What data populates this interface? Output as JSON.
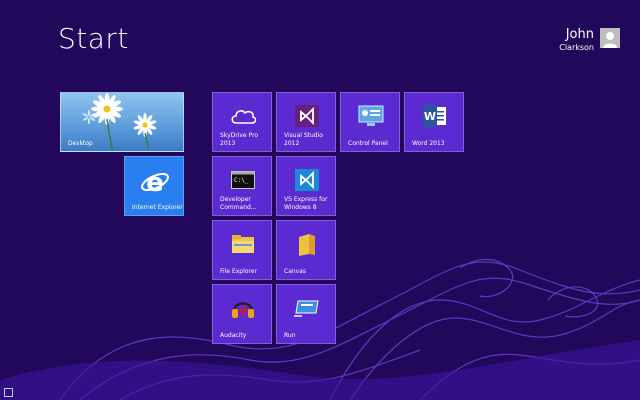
{
  "screen": {
    "title": "Start"
  },
  "user": {
    "first_name": "John",
    "last_name": "Clarkson"
  },
  "tiles": {
    "desktop": {
      "label": "Desktop"
    },
    "internet_explorer": {
      "label": "Internet Explorer"
    },
    "skydrive": {
      "label": "SkyDrive Pro\n2013"
    },
    "visual_studio": {
      "label": "Visual Studio\n2012"
    },
    "control_panel": {
      "label": "Control Panel"
    },
    "word": {
      "label": "Word 2013"
    },
    "dev_cmd": {
      "label": "Developer\nCommand..."
    },
    "vs_express": {
      "label": "VS Express for\nWindows 8"
    },
    "file_explorer": {
      "label": "File Explorer"
    },
    "canvas": {
      "label": "Canvas"
    },
    "audacity": {
      "label": "Audacity"
    },
    "run": {
      "label": "Run"
    }
  },
  "colors": {
    "background": "#22085a",
    "tile": "#5b2ad0",
    "ie_tile": "#2a7ff0"
  }
}
